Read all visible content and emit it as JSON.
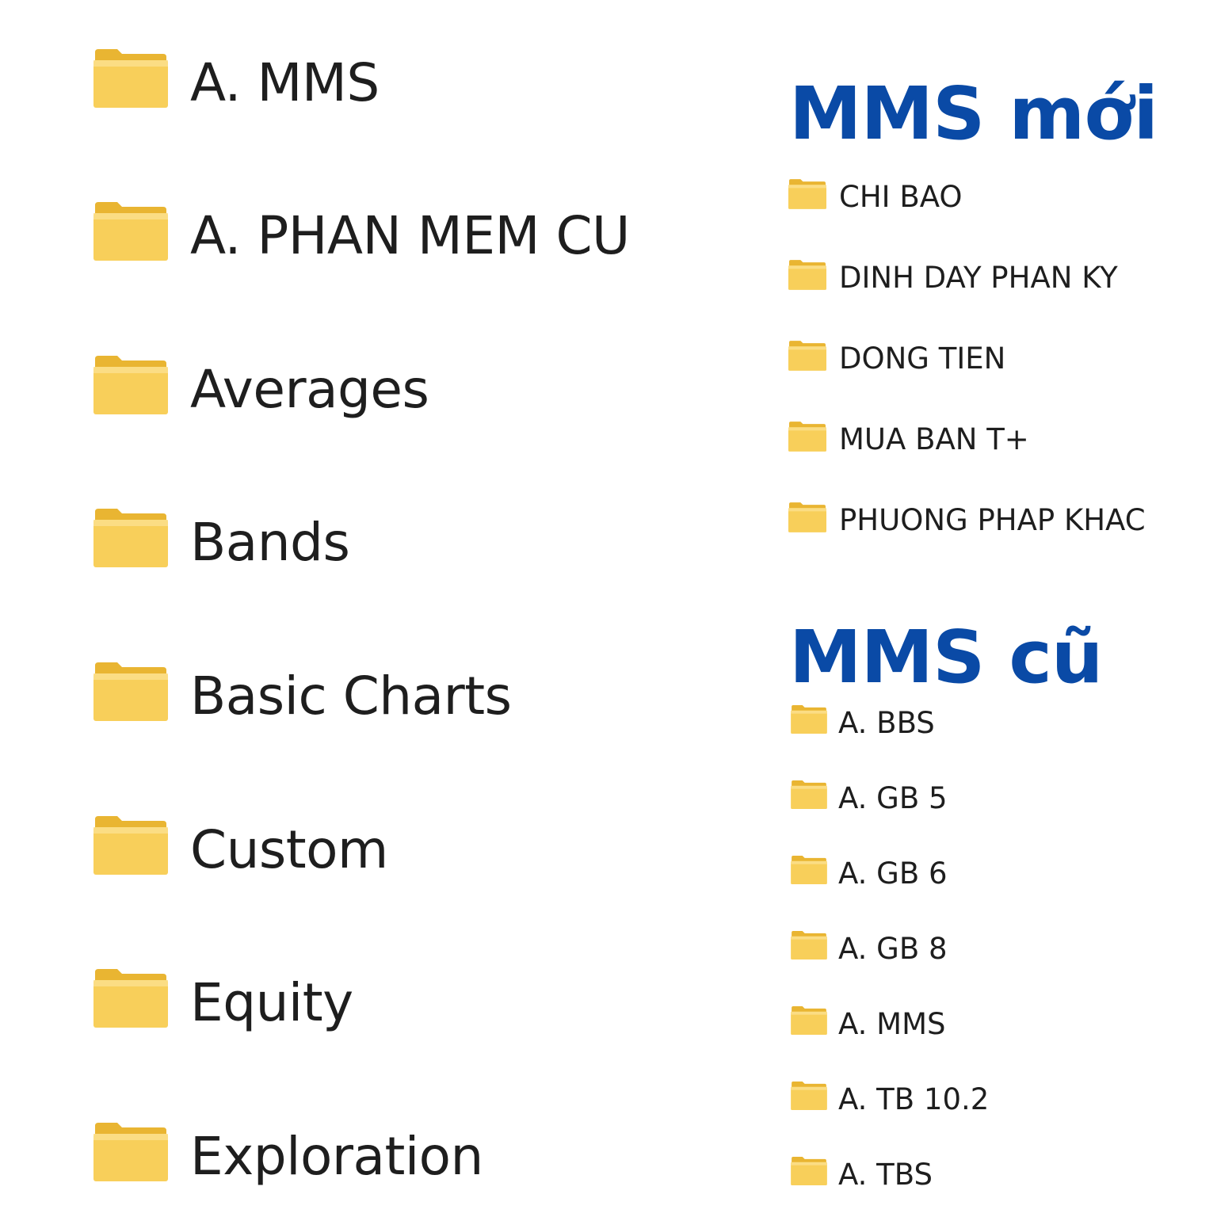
{
  "left_list": {
    "items": [
      {
        "label": "A. MMS"
      },
      {
        "label": "A. PHAN MEM CU"
      },
      {
        "label": "Averages"
      },
      {
        "label": "Bands"
      },
      {
        "label": "Basic Charts"
      },
      {
        "label": "Custom"
      },
      {
        "label": "Equity"
      },
      {
        "label": "Exploration"
      }
    ]
  },
  "new_section": {
    "title": "MMS mới",
    "items": [
      {
        "label": "CHI BAO"
      },
      {
        "label": "DINH DAY PHAN KY"
      },
      {
        "label": "DONG TIEN"
      },
      {
        "label": "MUA BAN T+"
      },
      {
        "label": "PHUONG PHAP KHAC"
      }
    ]
  },
  "old_section": {
    "title": "MMS cũ",
    "items": [
      {
        "label": "A. BBS"
      },
      {
        "label": "A. GB 5"
      },
      {
        "label": "A. GB 6"
      },
      {
        "label": "A. GB 8"
      },
      {
        "label": "A. MMS"
      },
      {
        "label": "A. TB 10.2"
      },
      {
        "label": "A. TBS"
      }
    ]
  },
  "colors": {
    "heading": "#0a4aa6",
    "folder_front": "#f8cf5a",
    "folder_back": "#e9b532",
    "text": "#1e1e1e"
  },
  "icon": "folder-icon"
}
